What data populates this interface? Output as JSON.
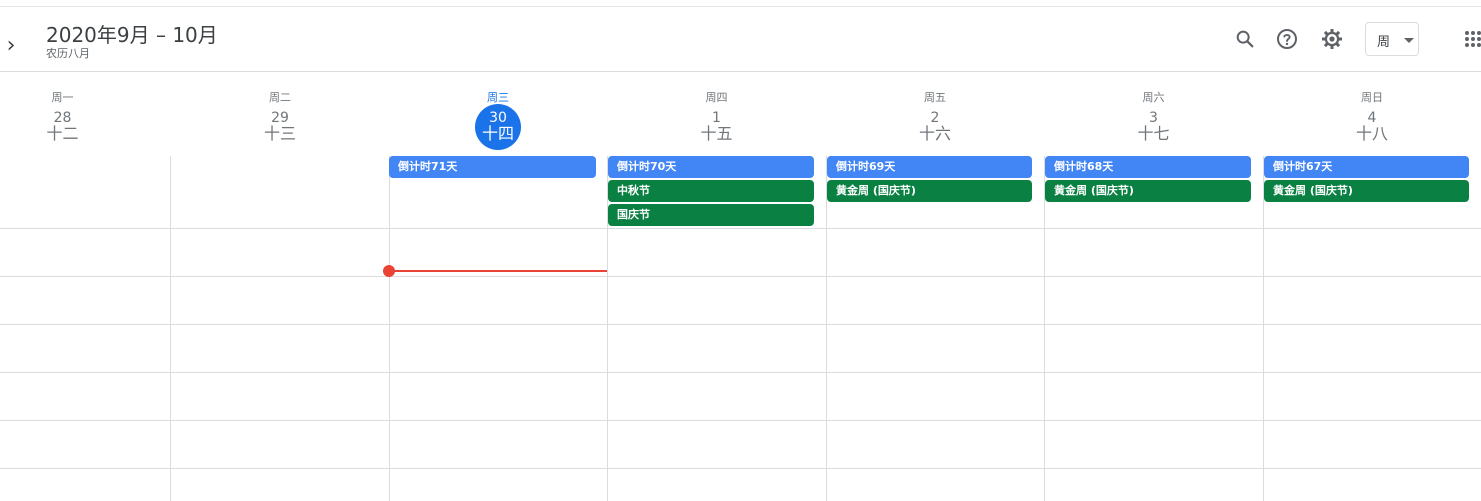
{
  "header": {
    "title": "2020年9月 – 10月",
    "subtitle": "农历八月",
    "nav_next_glyph": "›",
    "view_select_label": "周",
    "icons": [
      "search-icon",
      "help-icon",
      "settings-icon",
      "apps-grid-icon"
    ]
  },
  "days": [
    {
      "dow": "周一",
      "date": "28",
      "lunar": "十二"
    },
    {
      "dow": "周二",
      "date": "29",
      "lunar": "十三"
    },
    {
      "dow": "周三",
      "date": "30",
      "lunar": "十四",
      "today": true
    },
    {
      "dow": "周四",
      "date": "1",
      "lunar": "十五"
    },
    {
      "dow": "周五",
      "date": "2",
      "lunar": "十六"
    },
    {
      "dow": "周六",
      "date": "3",
      "lunar": "十七"
    },
    {
      "dow": "周日",
      "date": "4",
      "lunar": "十八"
    }
  ],
  "all_day_events": [
    {
      "title": "倒计时71天",
      "day": "周三",
      "color": "#4285f4"
    },
    {
      "title": "倒计时70天",
      "day": "周四",
      "color": "#4285f4"
    },
    {
      "title": "中秋节",
      "day": "周四",
      "color": "#0b8043"
    },
    {
      "title": "国庆节",
      "day": "周四",
      "color": "#0b8043"
    },
    {
      "title": "倒计时69天",
      "day": "周五",
      "color": "#4285f4"
    },
    {
      "title": "黄金周 (国庆节)",
      "day": "周五",
      "color": "#0b8043"
    },
    {
      "title": "倒计时68天",
      "day": "周六",
      "color": "#4285f4"
    },
    {
      "title": "黄金周 (国庆节)",
      "day": "周六",
      "color": "#0b8043"
    },
    {
      "title": "倒计时67天",
      "day": "周日",
      "color": "#4285f4"
    },
    {
      "title": "黄金周 (国庆节)",
      "day": "周日",
      "color": "#0b8043"
    }
  ],
  "colors": {
    "accent": "#1a73e8",
    "event_blue": "#4285f4",
    "event_green": "#0b8043",
    "now_indicator": "#ea4335"
  }
}
